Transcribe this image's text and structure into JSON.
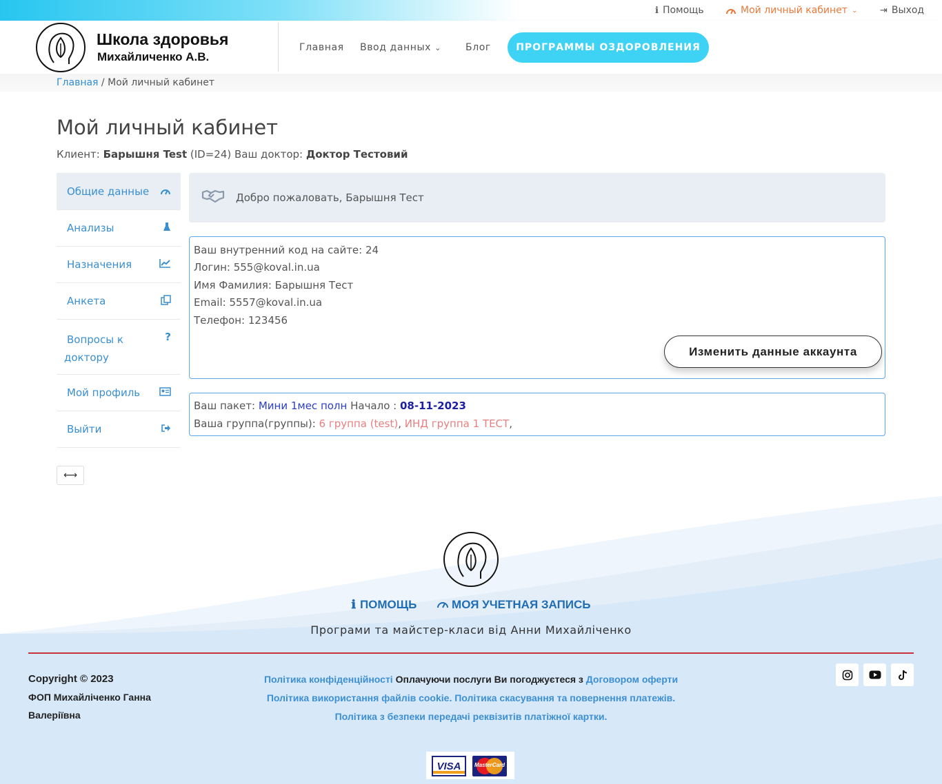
{
  "topbar": {
    "help": "Помощь",
    "cabinet": "Мой личный кабинет",
    "exit": "Выход"
  },
  "header": {
    "logo_title": "Школа здоровья",
    "logo_subtitle": "Михайличенко А.В.",
    "nav": {
      "home": "Главная",
      "input": "Ввод данных",
      "blog": "Блог",
      "programs_button": "ПРОГРАММЫ ОЗДОРОВЛЕНИЯ"
    }
  },
  "breadcrumb": {
    "home": "Главная",
    "separator": " / ",
    "current": "Мой личный кабинет"
  },
  "page": {
    "title": "Мой личный кабинет",
    "client_label": "Клиент: ",
    "client_name": "Барышня Test",
    "client_id": " (ID=24) ",
    "doctor_label": "Ваш доктор: ",
    "doctor_name": "Доктор Тестовий"
  },
  "sidebar": {
    "items": [
      {
        "label": "Общие данные",
        "icon": "dashboard-icon"
      },
      {
        "label": "Анализы",
        "icon": "flask-icon"
      },
      {
        "label": "Назначения",
        "icon": "chart-line-icon"
      },
      {
        "label": "Анкета",
        "icon": "copy-icon"
      },
      {
        "label": "Вопросы к доктору",
        "icon": "question-icon"
      },
      {
        "label": "Мой профиль",
        "icon": "id-card-icon"
      },
      {
        "label": "Выйти",
        "icon": "sign-out-icon"
      }
    ],
    "toggle_icon": "arrows-h-icon"
  },
  "welcome": {
    "text": "Добро пожаловать, Барышня Тест"
  },
  "account": {
    "internal_code": "Ваш внутренний код на сайте: 24",
    "login": "Логин: 555@koval.in.ua",
    "name": "Имя Фамилия: Барышня Тест",
    "email": "Email: 5557@koval.in.ua",
    "phone": "Телефон: 123456",
    "edit_button": "Изменить данные аккаунта"
  },
  "package": {
    "label": "Ваш пакет: ",
    "name": "Мини 1мес полн",
    "start_label": " Начало : ",
    "start_date": "08-11-2023",
    "group_label": "Ваша группа(группы): ",
    "groups": [
      "6 группа (test)",
      "ИНД группа 1 ТЕСТ"
    ]
  },
  "footer": {
    "help": "ПОМОЩЬ",
    "account": "МОЯ УЧЕТНАЯ ЗАПИСЬ",
    "tagline": "Програми та майстер-класи від Анни Михайліченко",
    "copyright": "Copyright © 2023",
    "owner": "ФОП Михайліченко Ганна Валеріївна",
    "privacy": "Політика конфіденційності",
    "agree_text": " Оплачуючи послуги Ви погоджуєтеся з ",
    "contract": "Договором оферти",
    "cookie_policy": "Політика використання файлів cookie. Політика скасування та повернення платежів.",
    "card_security": "Політика з безпеки передачі реквізитів платіжної картки.",
    "visa": "VISA",
    "mastercard": "MasterCard"
  },
  "colors": {
    "accent": "#3ed3f4",
    "link": "#3a8fd0",
    "cabinet_orange": "#e8793b",
    "footer_bg": "#d7e8f8",
    "divider_red": "#c9303a"
  }
}
